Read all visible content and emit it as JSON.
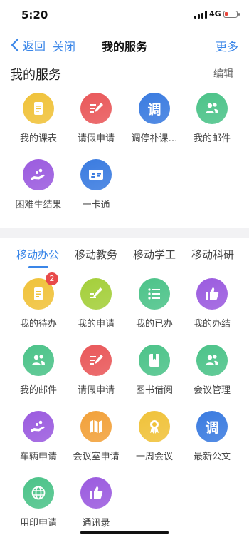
{
  "status_bar": {
    "time": "5:20",
    "network": "4G"
  },
  "nav": {
    "back": "返回",
    "close": "关闭",
    "title": "我的服务",
    "more": "更多"
  },
  "my_services": {
    "title": "我的服务",
    "edit": "编辑",
    "items": [
      {
        "label": "我的课表",
        "icon": "document-icon",
        "color": "#f0c23a"
      },
      {
        "label": "请假申请",
        "icon": "edit-form-icon",
        "color": "#e9585a"
      },
      {
        "label": "调停补课…",
        "icon": "tiao-char-icon",
        "glyph": "调",
        "color": "#3a7be0"
      },
      {
        "label": "我的邮件",
        "icon": "users-icon",
        "color": "#4cc389"
      },
      {
        "label": "困难生结果",
        "icon": "hand-coins-icon",
        "color": "#9b5bdf"
      },
      {
        "label": "一卡通",
        "icon": "id-card-icon",
        "color": "#3a7be0"
      }
    ]
  },
  "tabs": [
    {
      "label": "移动办公",
      "active": true
    },
    {
      "label": "移动教务",
      "active": false
    },
    {
      "label": "移动学工",
      "active": false
    },
    {
      "label": "移动科研",
      "active": false
    }
  ],
  "office": {
    "items": [
      {
        "label": "我的待办",
        "icon": "document-icon",
        "color": "#f0c23a",
        "badge": "2"
      },
      {
        "label": "我的申请",
        "icon": "edit-icon",
        "color": "#a4cf3a"
      },
      {
        "label": "我的已办",
        "icon": "list-icon",
        "color": "#4cc389"
      },
      {
        "label": "我的办结",
        "icon": "thumbs-up-icon",
        "color": "#9b5bdf"
      },
      {
        "label": "我的邮件",
        "icon": "users-icon",
        "color": "#4cc389"
      },
      {
        "label": "请假申请",
        "icon": "edit-form-icon",
        "color": "#e9585a"
      },
      {
        "label": "图书借阅",
        "icon": "book-icon",
        "color": "#4cc389"
      },
      {
        "label": "会议管理",
        "icon": "users-icon",
        "color": "#4cc389"
      },
      {
        "label": "车辆申请",
        "icon": "hand-coins-icon",
        "color": "#9b5bdf"
      },
      {
        "label": "会议室申请",
        "icon": "map-icon",
        "color": "#f2a13a"
      },
      {
        "label": "一周会议",
        "icon": "award-icon",
        "color": "#f0c23a"
      },
      {
        "label": "最新公文",
        "icon": "tiao-char-icon",
        "glyph": "调",
        "color": "#3a7be0"
      },
      {
        "label": "用印申请",
        "icon": "globe-icon",
        "color": "#4cc389"
      },
      {
        "label": "通讯录",
        "icon": "thumbs-up-icon",
        "color": "#9b5bdf"
      }
    ]
  }
}
